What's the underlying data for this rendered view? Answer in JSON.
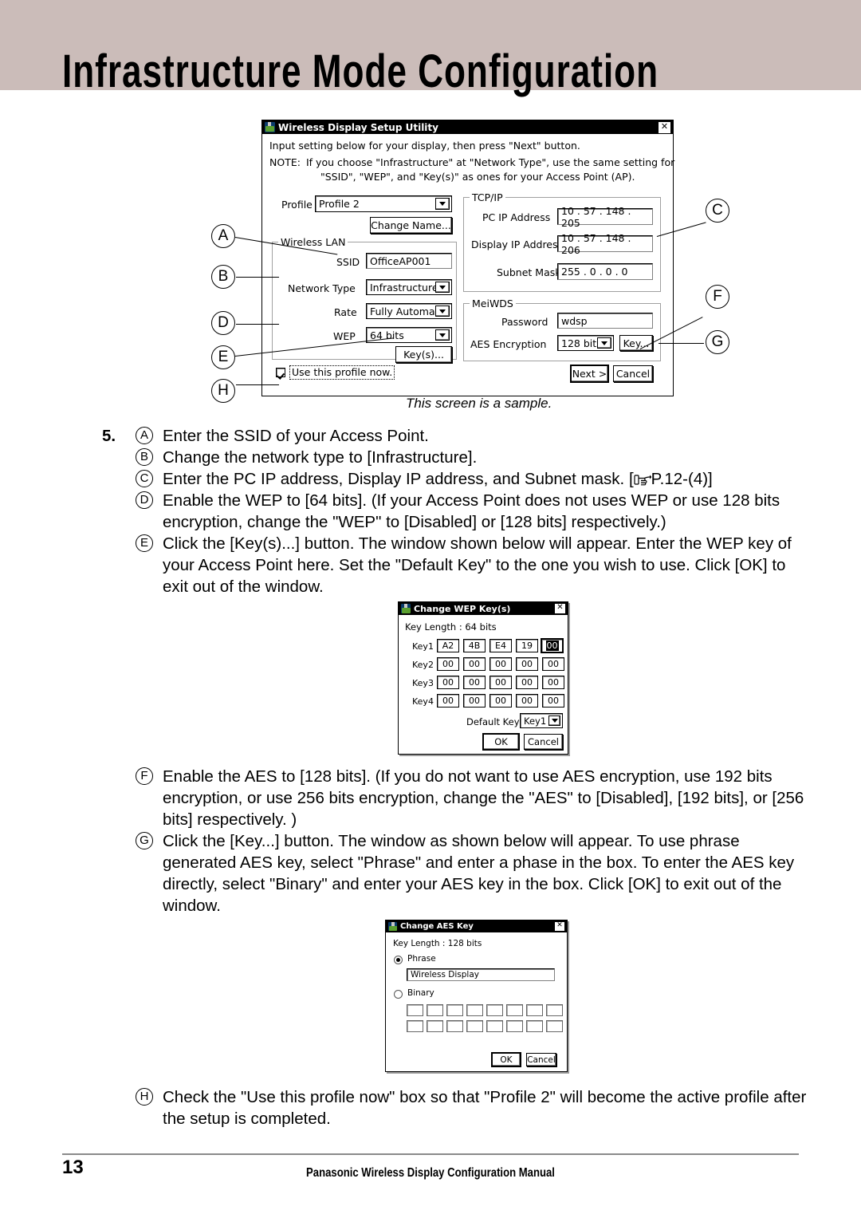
{
  "header": {
    "title": "Infrastructure Mode Configuration",
    "band_color": "#cbbcb9"
  },
  "main_dialog": {
    "title": "Wireless Display Setup Utility",
    "close_label": "✕",
    "instruction": "Input setting below for your display, then press \"Next\" button.",
    "note_label": "NOTE:",
    "note_line1": "If you choose \"Infrastructure\" at \"Network Type\", use the same setting for",
    "note_line2": "\"SSID\", \"WEP\", and \"Key(s)\" as ones for your Access Point (AP).",
    "profile_label": "Profile",
    "profile_value": "Profile 2",
    "change_name_label": "Change Name...",
    "wireless_lan_group": "Wireless LAN",
    "ssid_label": "SSID",
    "ssid_value": "OfficeAP001",
    "network_type_label": "Network Type",
    "network_type_value": "Infrastructure",
    "rate_label": "Rate",
    "rate_value": "Fully Automatic",
    "wep_label": "WEP",
    "wep_value": "64 bits",
    "keys_button_label": "Key(s)...",
    "tcpip_group": "TCP/IP",
    "pc_ip_label": "PC IP Address",
    "pc_ip_value": "10  . 57  . 148 . 205",
    "display_ip_label": "Display IP Address",
    "display_ip_value": "10  . 57  . 148 . 206",
    "subnet_label": "Subnet Mask",
    "subnet_value": "255 .  0   .  0   .  0",
    "meiwds_group": "MeiWDS",
    "password_label": "Password",
    "password_value": "wdsp",
    "aes_label": "AES Encryption",
    "aes_value": "128 bits",
    "aes_key_button_label": "Key...",
    "use_profile_label": "Use this profile now.",
    "use_profile_checked": true,
    "next_button_label": "Next >",
    "cancel_button_label": "Cancel"
  },
  "callouts": {
    "a": "A",
    "b": "B",
    "c": "C",
    "d": "D",
    "e": "E",
    "f": "F",
    "g": "G",
    "h": "H"
  },
  "sample_caption": "This screen is a sample.",
  "steps": {
    "number": "5.",
    "items": [
      {
        "marker": "A",
        "text": "Enter the SSID of your Access Point."
      },
      {
        "marker": "B",
        "text": "Change the network type to [Infrastructure]."
      },
      {
        "marker": "C",
        "text_before": "Enter the PC IP address, Display IP address, and Subnet mask. [",
        "reference": "P.12-(4)]"
      },
      {
        "marker": "D",
        "text": "Enable the WEP to [64 bits]. (If your Access Point does not uses WEP or use 128 bits encryption, change the \"WEP\" to [Disabled] or [128 bits] respectively.)"
      },
      {
        "marker": "E",
        "text": "Click the [Key(s)...] button. The window  shown below will appear. Enter the WEP key of your Access Point here. Set the \"Default Key\" to the one you wish to use. Click [OK] to exit out of the window."
      },
      {
        "marker": "F",
        "text": "Enable the AES to [128 bits]. (If you do not want to use AES encryption, use 192 bits encryption, or use 256 bits encryption, change the \"AES\" to [Disabled], [192 bits], or [256 bits] respectively. )"
      },
      {
        "marker": "G",
        "text": "Click the [Key...] button. The window as shown below will appear. To use phrase generated AES key, select \"Phrase\" and enter a phase in the box. To enter the AES key directly, select \"Binary\" and enter your AES key in the box. Click [OK] to exit out of the window."
      },
      {
        "marker": "H",
        "text": "Check the \"Use this profile now\" box so that \"Profile 2\" will become the active profile after the setup is completed."
      }
    ]
  },
  "wep_dialog": {
    "title": "Change WEP Key(s)",
    "close_label": "✕",
    "key_length": "Key Length : 64 bits",
    "rows": [
      {
        "label": "Key1",
        "values": [
          "A2",
          "4B",
          "E4",
          "19",
          "00"
        ],
        "selected_index": 4
      },
      {
        "label": "Key2",
        "values": [
          "00",
          "00",
          "00",
          "00",
          "00"
        ],
        "selected_index": -1
      },
      {
        "label": "Key3",
        "values": [
          "00",
          "00",
          "00",
          "00",
          "00"
        ],
        "selected_index": -1
      },
      {
        "label": "Key4",
        "values": [
          "00",
          "00",
          "00",
          "00",
          "00"
        ],
        "selected_index": -1
      }
    ],
    "default_key_label": "Default Key",
    "default_key_value": "Key1",
    "ok_label": "OK",
    "cancel_label": "Cancel"
  },
  "aes_dialog": {
    "title": "Change AES Key",
    "close_label": "✕",
    "key_length": "Key Length : 128 bits",
    "phrase_label": "Phrase",
    "phrase_selected": true,
    "phrase_value": "Wireless Display",
    "binary_label": "Binary",
    "binary_selected": false,
    "binary_cell_count": 16,
    "ok_label": "OK",
    "cancel_label": "Cancel"
  },
  "footer": {
    "page_number": "13",
    "text": "Panasonic Wireless Display Configuration Manual"
  }
}
